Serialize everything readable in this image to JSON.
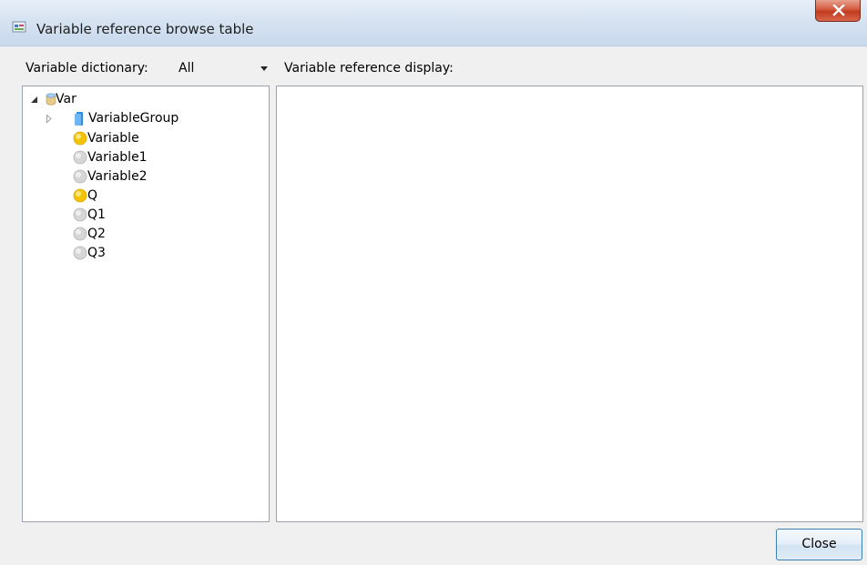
{
  "window": {
    "title": "Variable reference browse table"
  },
  "toolbar": {
    "dictionary_label": "Variable dictionary:",
    "dictionary_value": "All",
    "display_label": "Variable reference display:"
  },
  "tree": {
    "root": {
      "label": "Var",
      "expanded": true
    },
    "group": {
      "label": "VariableGroup",
      "expanded": false
    },
    "items": [
      {
        "label": "Variable",
        "state": "active"
      },
      {
        "label": "Variable1",
        "state": "inactive"
      },
      {
        "label": "Variable2",
        "state": "inactive"
      },
      {
        "label": "Q",
        "state": "active"
      },
      {
        "label": "Q1",
        "state": "inactive"
      },
      {
        "label": "Q2",
        "state": "inactive"
      },
      {
        "label": "Q3",
        "state": "inactive"
      }
    ]
  },
  "footer": {
    "close_label": "Close"
  },
  "colors": {
    "active_dot": "#f5c400",
    "inactive_dot": "#d0d0d0",
    "accent_border": "#3c7fb1"
  }
}
